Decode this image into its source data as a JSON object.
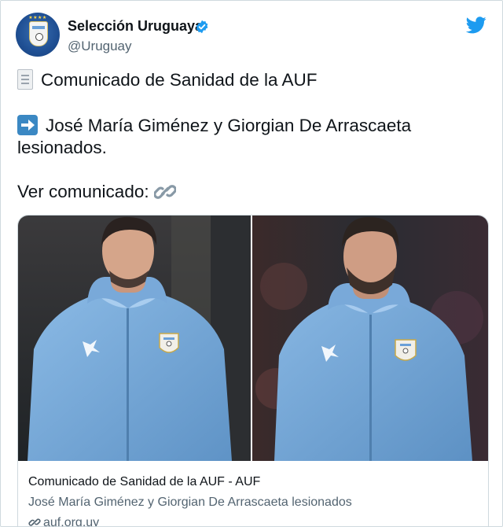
{
  "account": {
    "name": "Selección Uruguaya",
    "handle": "@Uruguay",
    "verified": true,
    "avatar_icon": "auf-crest-icon"
  },
  "tweet": {
    "line1": "Comunicado de Sanidad de la AUF",
    "line2": "José María Giménez y Giorgian De Arrascaeta",
    "line3": "lesionados.",
    "line4": "Ver comunicado:",
    "line1_icon": "document-icon",
    "line2_icon": "right-arrow-icon",
    "line4_icon": "link-icon"
  },
  "card": {
    "title": "Comunicado de Sanidad de la AUF - AUF",
    "description": "José María Giménez y Giorgian De Arrascaeta lesionados",
    "domain": "auf.org.uy"
  },
  "colors": {
    "twitter_blue": "#1d9bf0",
    "text_primary": "#0f1419",
    "text_secondary": "#536471",
    "border": "#cfd9de",
    "jacket": "#7fb0de"
  }
}
